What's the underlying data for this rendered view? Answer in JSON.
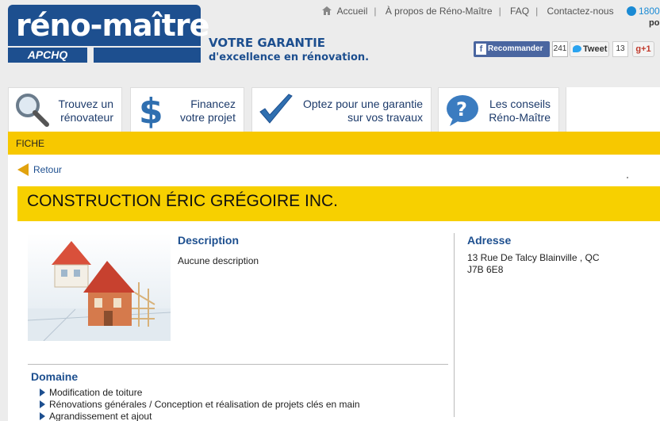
{
  "brand": {
    "logo_text": "réno-maître",
    "logo_sub": "APCHQ",
    "tagline_line1": "VOTRE GARANTIE",
    "tagline_line2": "d'excellence en rénovation.",
    "color": "#1d4f8f"
  },
  "topnav": {
    "items": [
      "Accueil",
      "À propos de Réno-Maître",
      "FAQ",
      "Contactez-nous"
    ],
    "phone_partial": "1800",
    "right_partial": "po"
  },
  "social": {
    "facebook_label": "Recommander",
    "facebook_count": "241",
    "tweet_label": "Tweet",
    "tweet_count": "13",
    "gplus_label": "g+1"
  },
  "tiles": [
    {
      "line1": "Trouvez un",
      "line2": "rénovateur",
      "icon": "magnifier-icon"
    },
    {
      "line1": "Financez",
      "line2": "votre projet",
      "icon": "dollar-icon"
    },
    {
      "line1": "Optez pour une garantie",
      "line2": "sur vos travaux",
      "icon": "checkmark-icon"
    },
    {
      "line1": "Les conseils",
      "line2": "Réno-Maître",
      "icon": "question-icon"
    }
  ],
  "breadcrumb": "FICHE",
  "back_label": "Retour",
  "company_name": "CONSTRUCTION ÉRIC GRÉGOIRE INC.",
  "description": {
    "heading": "Description",
    "text": "Aucune description"
  },
  "address": {
    "heading": "Adresse",
    "line1": "13 Rue De Talcy Blainville , QC",
    "line2": "J7B 6E8"
  },
  "domain": {
    "heading": "Domaine",
    "items": [
      "Modification de toiture",
      "Rénovations générales / Conception et réalisation de projets clés en main",
      "Agrandissement et ajout"
    ]
  },
  "colors": {
    "accent_yellow": "#f7c800",
    "link_blue": "#1d4f8f"
  }
}
